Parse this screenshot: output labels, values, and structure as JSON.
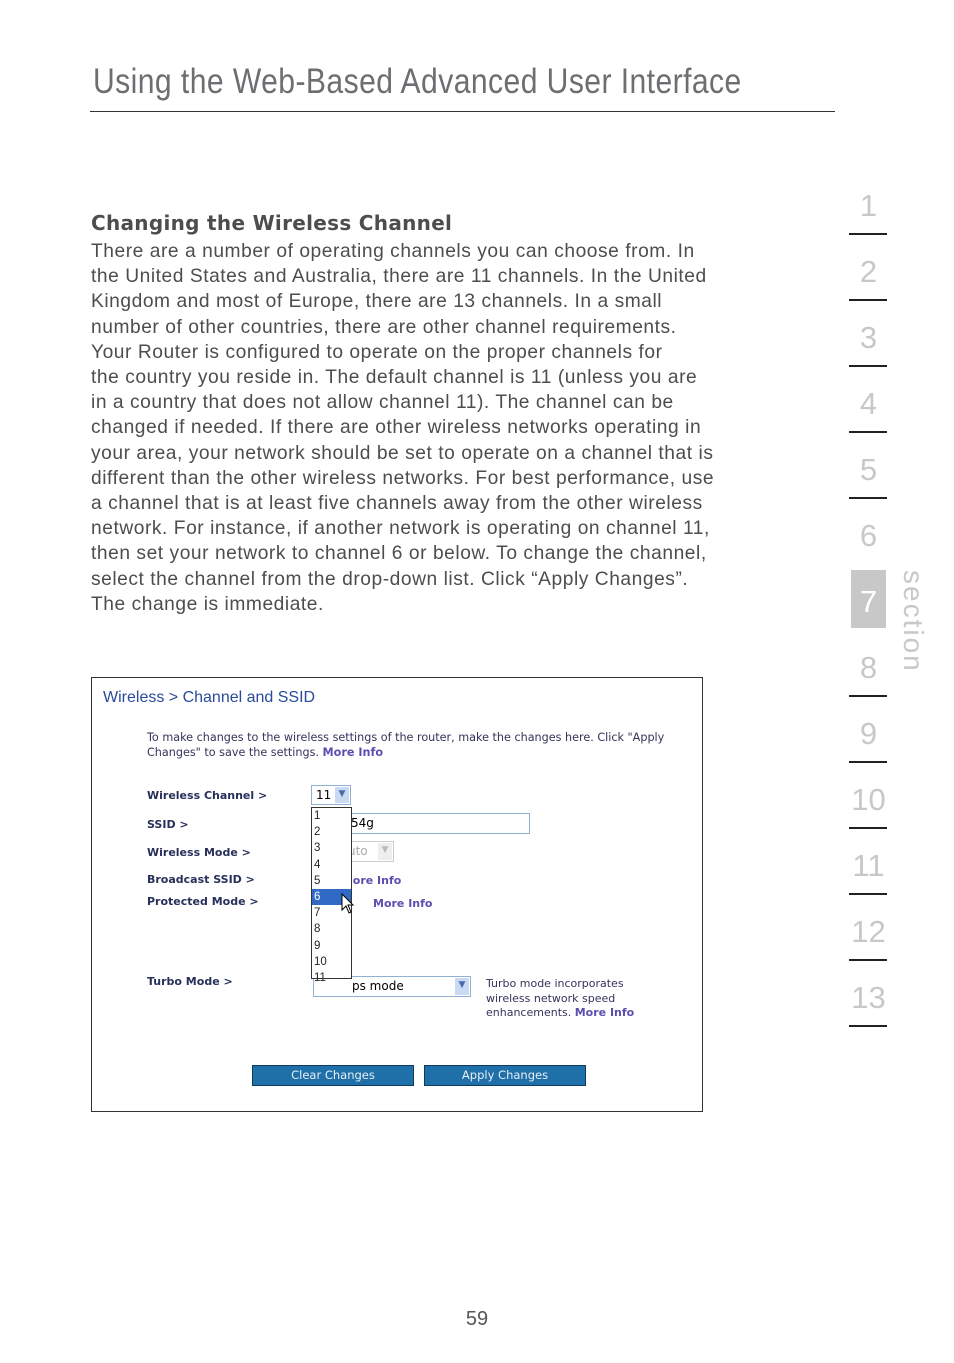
{
  "page_title": "Using the Web-Based Advanced User Interface",
  "section_heading": "Changing the Wireless Channel",
  "body_lines": [
    "There are a number of operating channels you can choose from. In",
    "the United States and Australia, there are 11 channels. In the United",
    "Kingdom and most of Europe, there are 13 channels. In a small",
    "number of other countries, there are other channel requirements.",
    "Your Router is configured to operate on the proper channels for",
    "the country you reside in. The default channel is 11 (unless you are",
    "in a country that does not allow channel 11). The channel can be",
    "changed if needed. If there are other wireless networks operating in",
    "your area, your network should be set to operate on a channel that is",
    "different than the other wireless networks. For best performance, use",
    "a channel that is at least five channels away from the other wireless",
    "network. For instance, if another network is operating on channel 11,",
    "then set your network to channel 6 or below. To change the channel,",
    "select the channel from the drop-down list. Click “Apply Changes”.",
    "The change is immediate."
  ],
  "sidebar": {
    "sections": [
      "1",
      "2",
      "3",
      "4",
      "5",
      "6",
      "7",
      "8",
      "9",
      "10",
      "11",
      "12",
      "13"
    ],
    "active": "7",
    "label": "section"
  },
  "screenshot": {
    "breadcrumb": "Wireless > Channel and SSID",
    "intro": "To make changes to the wireless settings of the router, make the changes here. Click \"Apply Changes\" to save the settings.",
    "more_info": "More Info",
    "labels": {
      "channel": "Wireless Channel >",
      "ssid": "SSID >",
      "mode": "Wireless Mode >",
      "broadcast": "Broadcast SSID >",
      "protected": "Protected Mode >",
      "turbo": "Turbo Mode >"
    },
    "channel_value": "11",
    "channel_options": [
      "1",
      "2",
      "3",
      "4",
      "5",
      "6",
      "7",
      "8",
      "9",
      "10",
      "11"
    ],
    "channel_highlighted": "6",
    "ssid_visible": "54g",
    "mode_visible": "uto",
    "broadcast_more_visible": "lore Info",
    "turbo_value_visible": "ps mode",
    "turbo_desc": "Turbo mode incorporates wireless network speed enhancements.",
    "clear_button": "Clear Changes",
    "apply_button": "Apply Changes"
  },
  "page_number": "59"
}
